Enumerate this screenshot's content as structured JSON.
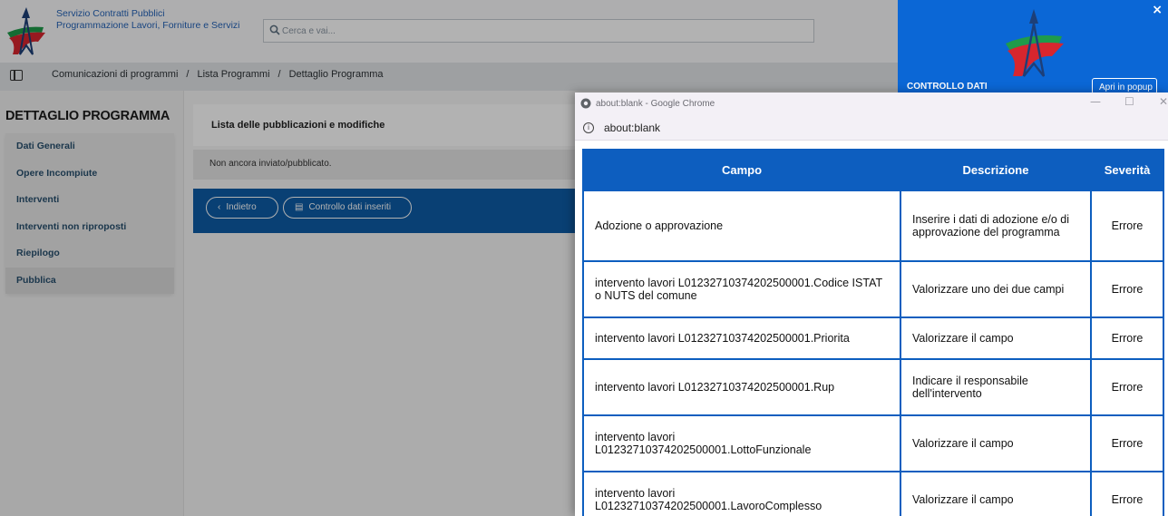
{
  "app": {
    "brand_line1": "Servizio Contratti Pubblici",
    "brand_line2": "Programmazione Lavori, Forniture e Servizi",
    "search_placeholder": "Cerca e vai...",
    "breadcrumb": [
      "Comunicazioni di programmi",
      "Lista Programmi",
      "Dettaglio Programma"
    ],
    "breadcrumb_separator": "/",
    "sidebar": {
      "title": "DETTAGLIO PROGRAMMA",
      "items": [
        "Dati Generali",
        "Opere Incompiute",
        "Interventi",
        "Interventi non riproposti",
        "Riepilogo",
        "Pubblica"
      ],
      "active_item": "Pubblica"
    },
    "main": {
      "section_title": "Lista delle pubblicazioni e modifiche",
      "status_text": "Non ancora inviato/pubblicato.",
      "back_button": "Indietro",
      "check_button": "Controllo dati inseriti"
    }
  },
  "right_panel": {
    "title": "CONTROLLO DATI",
    "popup_button": "Apri in popup",
    "close_label": "×"
  },
  "popup_window": {
    "title": "about:blank - Google Chrome",
    "url": "about:blank",
    "table": {
      "headers": [
        "Campo",
        "Descrizione",
        "Severità"
      ],
      "rows": [
        {
          "campo": "Adozione o approvazione",
          "descrizione": "Inserire i dati di adozione e/o di approvazione del programma",
          "severita": "Errore"
        },
        {
          "campo": "intervento lavori L01232710374202500001.Codice ISTAT o NUTS del comune",
          "descrizione": "Valorizzare uno dei due campi",
          "severita": "Errore"
        },
        {
          "campo": "intervento lavori L01232710374202500001.Priorita",
          "descrizione": "Valorizzare il campo",
          "severita": "Errore"
        },
        {
          "campo": "intervento lavori L01232710374202500001.Rup",
          "descrizione": "Indicare il responsabile dell'intervento",
          "severita": "Errore"
        },
        {
          "campo": "intervento lavori L01232710374202500001.LottoFunzionale",
          "descrizione": "Valorizzare il campo",
          "severita": "Errore"
        },
        {
          "campo": "intervento lavori L01232710374202500001.LavoroComplesso",
          "descrizione": "Valorizzare il campo",
          "severita": "Errore"
        }
      ]
    }
  },
  "colors": {
    "brand_blue": "#0d5ebf",
    "action_bar_blue": "#0d5ca7",
    "panel_blue": "#0b67d6",
    "logo_red": "#d8262e",
    "logo_green": "#1f9b4a"
  }
}
